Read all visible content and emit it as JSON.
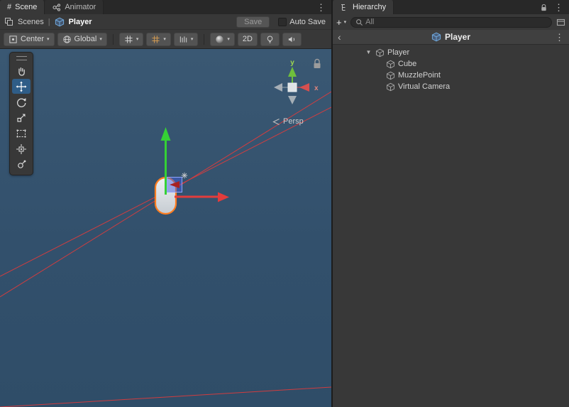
{
  "icons": {
    "kebab": "⋮",
    "caret": "▾",
    "foldout": "▼",
    "plus": "+",
    "hash": "#",
    "back": "‹",
    "pipe": "|"
  },
  "scene_panel": {
    "tabs": {
      "scene": "Scene",
      "animator": "Animator"
    },
    "breadcrumb": {
      "root": "Scenes",
      "current": "Player"
    },
    "save_label": "Save",
    "auto_save_label": "Auto Save",
    "toolbar": {
      "pivot_mode": "Center",
      "orientation_mode": "Global",
      "mode_2d": "2D"
    },
    "viewport": {
      "projection_label": "Persp",
      "axis_x": "x",
      "axis_y": "y"
    }
  },
  "hierarchy_panel": {
    "tab": "Hierarchy",
    "search_placeholder": "All",
    "prefab_name": "Player",
    "tree": [
      {
        "label": "Player"
      },
      {
        "label": "Cube"
      },
      {
        "label": "MuzzlePoint"
      },
      {
        "label": "Virtual Camera"
      }
    ]
  },
  "colors": {
    "selection_outline": "#ff7d1f",
    "tool_active": "#2f5d87",
    "scene_background": "#32506c",
    "axis_x_red": "#d64f4f",
    "axis_y_green": "#6fbf3c",
    "frustum_red": "#e23b3b"
  }
}
